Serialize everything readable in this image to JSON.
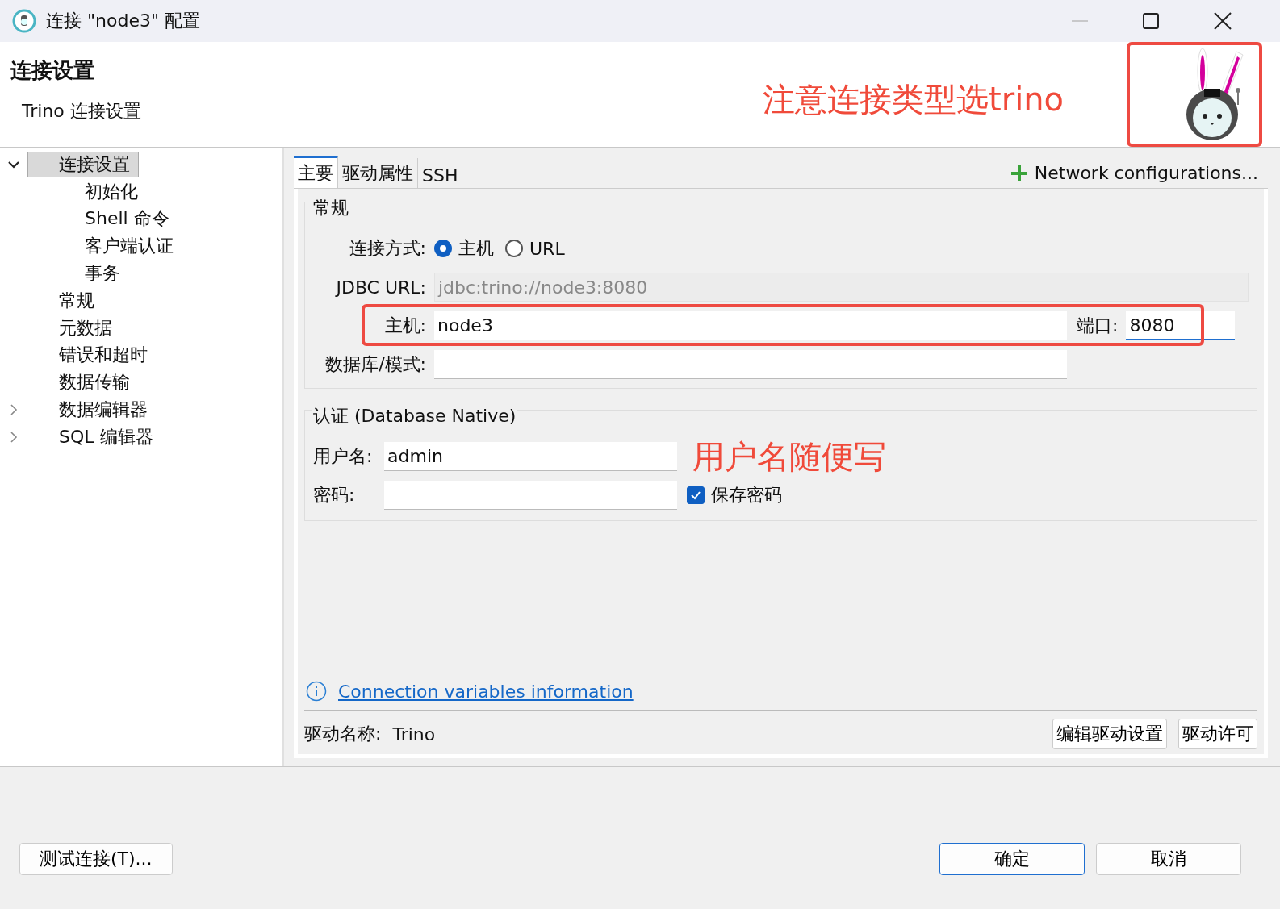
{
  "window": {
    "title": "连接 \"node3\" 配置"
  },
  "header": {
    "title": "连接设置",
    "subtitle": "Trino 连接设置"
  },
  "annotations": {
    "connection_type": "注意连接类型选trino",
    "username": "用户名随便写"
  },
  "tree": [
    {
      "label": "连接设置",
      "kind": "folder",
      "expanded": true,
      "selected": true,
      "children": [
        {
          "label": "初始化",
          "selected": false
        },
        {
          "label": "Shell 命令",
          "selected": false
        },
        {
          "label": "客户端认证",
          "selected": false
        },
        {
          "label": "事务",
          "selected": false
        }
      ]
    },
    {
      "label": "常规",
      "kind": "leaf",
      "selected": false
    },
    {
      "label": "元数据",
      "kind": "leaf",
      "selected": false
    },
    {
      "label": "错误和超时",
      "kind": "leaf",
      "selected": false
    },
    {
      "label": "数据传输",
      "kind": "leaf",
      "selected": false
    },
    {
      "label": "数据编辑器",
      "kind": "folder",
      "expanded": false,
      "selected": false
    },
    {
      "label": "SQL 编辑器",
      "kind": "folder",
      "expanded": false,
      "selected": false
    }
  ],
  "tabs": [
    {
      "label": "主要",
      "selected": true
    },
    {
      "label": "驱动属性",
      "selected": false
    },
    {
      "label": "SSH",
      "selected": false
    }
  ],
  "network_button": "Network configurations...",
  "general": {
    "title": "常规",
    "connect_by": {
      "label": "连接方式:",
      "options": [
        {
          "label": "主机",
          "selected": true
        },
        {
          "label": "URL",
          "selected": false
        }
      ]
    },
    "jdbc_url": {
      "label": "JDBC URL:",
      "value": "jdbc:trino://node3:8080"
    },
    "host": {
      "label": "主机:",
      "value": "node3"
    },
    "port": {
      "label": "端口:",
      "value": "8080"
    },
    "database": {
      "label": "数据库/模式:"
    }
  },
  "auth": {
    "title": "认证 (Database Native)",
    "username": {
      "label": "用户名:",
      "value": "admin"
    },
    "password": {
      "label": "密码:"
    },
    "save_password": {
      "label": "保存密码",
      "checked": true
    }
  },
  "link": "Connection variables information",
  "driver": {
    "label": "驱动名称:",
    "value": "Trino",
    "buttons": [
      "编辑驱动设置",
      "驱动许可"
    ]
  },
  "footer": {
    "test_button": "测试连接(T)...",
    "buttons": [
      {
        "label": "确定",
        "default": true
      },
      {
        "label": "取消",
        "default": false
      }
    ]
  }
}
